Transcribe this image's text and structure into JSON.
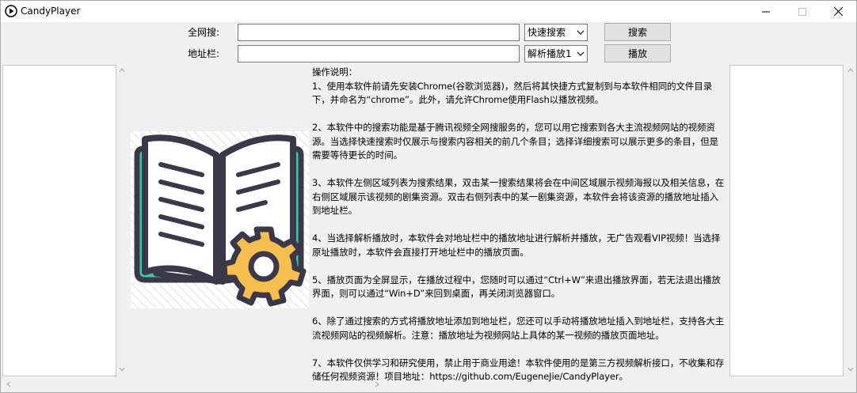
{
  "window": {
    "title": "CandyPlayer"
  },
  "form": {
    "search_label": "全网搜:",
    "address_label": "地址栏:",
    "search_value": "",
    "address_value": "",
    "search_mode": "快速搜索",
    "play_mode": "解析播放1",
    "search_button": "搜索",
    "play_button": "播放"
  },
  "instructions": {
    "heading": "操作说明：",
    "p1": "1、使用本软件前请先安装Chrome(谷歌浏览器)，然后将其快捷方式复制到与本软件相同的文件目录下，并命名为“chrome”。此外，请允许Chrome使用Flash以播放视频。",
    "p2": "2、本软件中的搜索功能是基于腾讯视频全网搜服务的，您可以用它搜索到各大主流视频网站的视频资源。当选择快速搜索时仅展示与搜索内容相关的前几个条目；选择详细搜索可以展示更多的条目，但是需要等待更长的时间。",
    "p3": "3、本软件左侧区域列表为搜索结果，双击某一搜索结果将会在中间区域展示视频海报以及相关信息，在右侧区域展示该视频的剧集资源。双击右侧列表中的某一剧集资源，本软件会将该资源的播放地址插入到地址栏。",
    "p4": "4、当选择解析播放时，本软件会对地址栏中的播放地址进行解析并播放，无广告观看VIP视频！当选择原址播放时，本软件会直接打开地址栏中的播放页面。",
    "p5": "5、播放页面为全屏显示，在播放过程中，您随时可以通过“Ctrl+W”来退出播放界面，若无法退出播放界面，则可以通过“Win+D”来回到桌面，再关闭浏览器窗口。",
    "p6": "6、除了通过搜索的方式将播放地址添加到地址栏，您还可以手动将播放地址插入到地址栏，支持各大主流视频网站的视频解析。注意：播放地址为视频网站上具体的某一视频的播放页面地址。",
    "p7": "7、本软件仅供学习和研究使用，禁止用于商业用途！本软件使用的是第三方视频解析接口，不收集和存储任何视频资源！项目地址：https://github.com/EugeneJie/CandyPlayer。"
  },
  "icons": {
    "app": "play-circle-icon",
    "poster": "book-gear-icon"
  },
  "colors": {
    "book_teal": "#3cc7a4",
    "book_dark": "#3b3849",
    "gear_yellow": "#f6be4f"
  }
}
